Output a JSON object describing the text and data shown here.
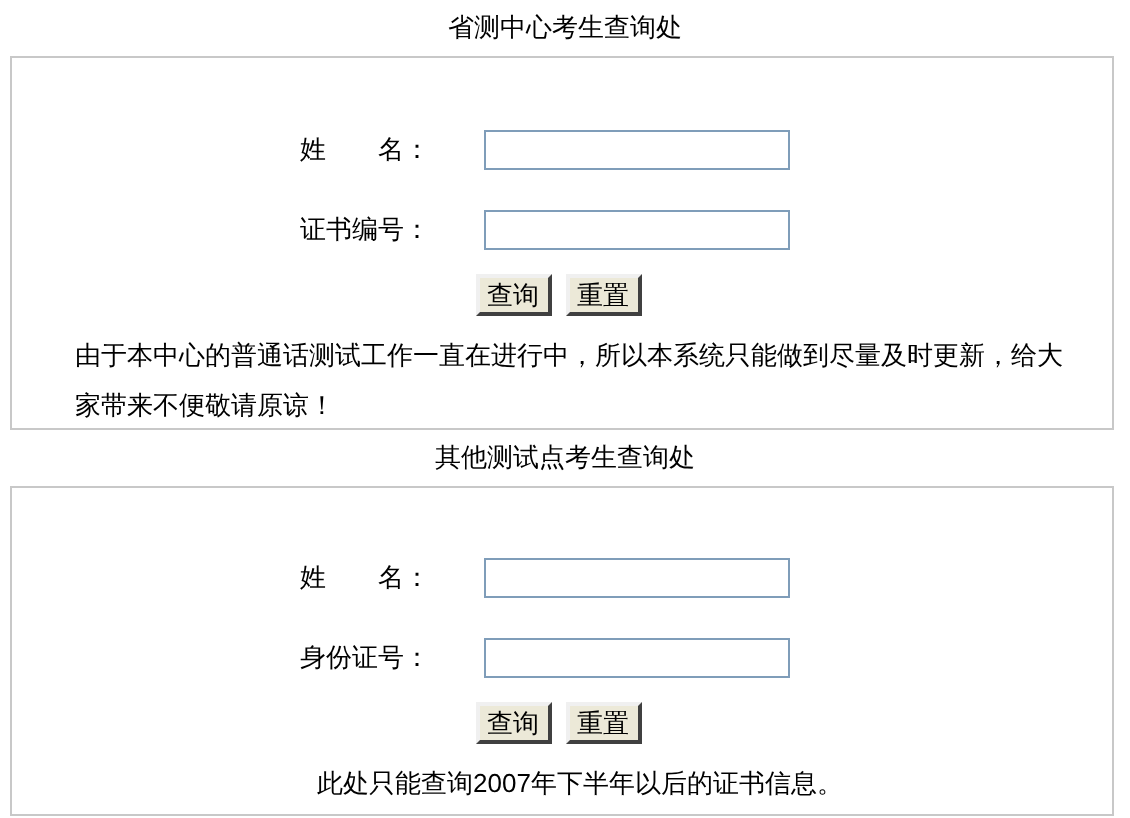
{
  "sections": [
    {
      "title": "省测中心考生查询处",
      "fields": [
        {
          "label": "姓　　名："
        },
        {
          "label": "证书编号："
        }
      ],
      "buttons": [
        "查询",
        "重置"
      ],
      "note": "由于本中心的普通话测试工作一直在进行中，所以本系统只能做到尽量及时更新，给大家带来不便敬请原谅！"
    },
    {
      "title": "其他测试点考生查询处",
      "fields": [
        {
          "label": "姓　　名："
        },
        {
          "label": "身份证号："
        }
      ],
      "buttons": [
        "查询",
        "重置"
      ],
      "note": "此处只能查询2007年下半年以后的证书信息。"
    }
  ]
}
